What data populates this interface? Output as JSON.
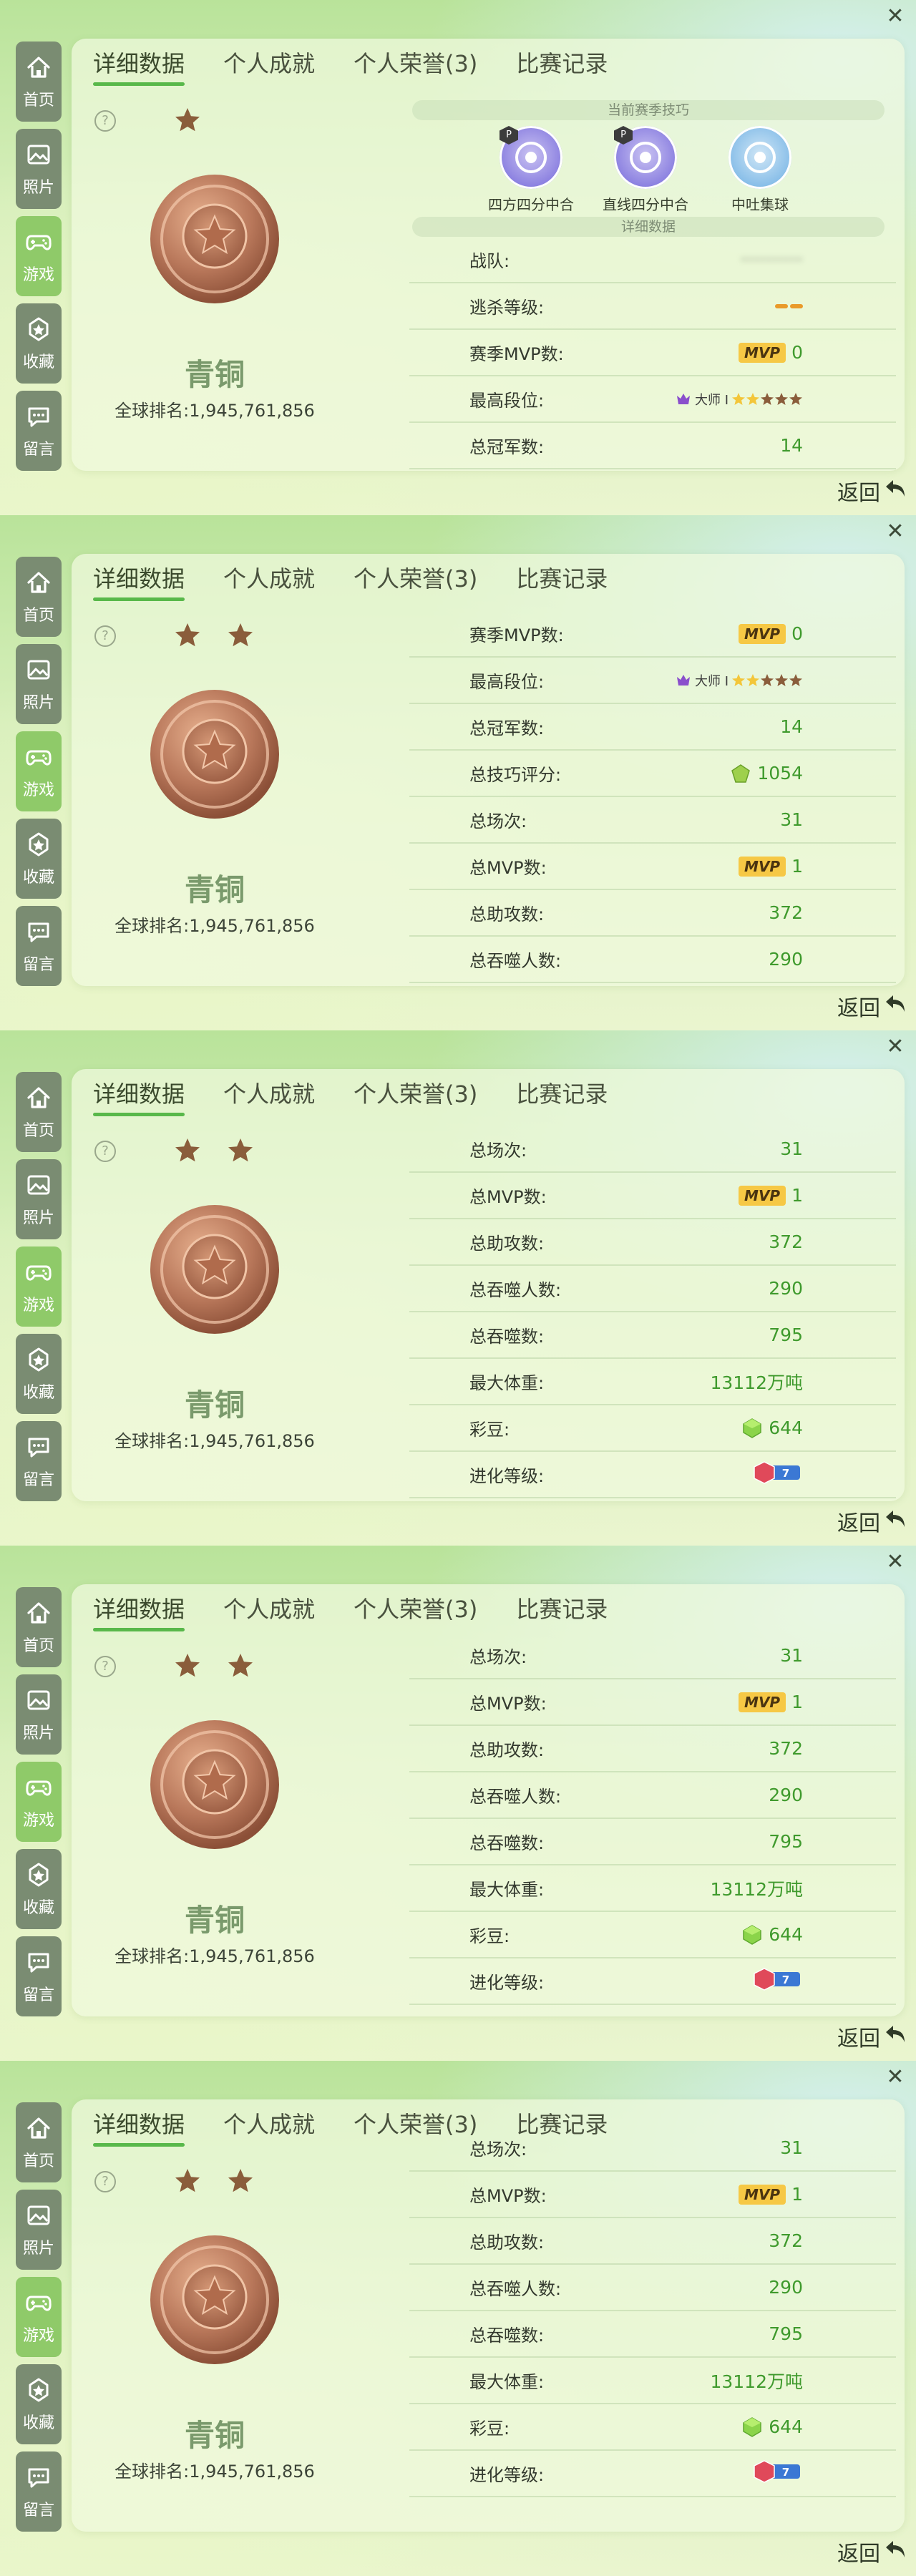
{
  "close_symbol": "✕",
  "sidebar": [
    {
      "label": "首页",
      "icon": "home-icon",
      "active": false
    },
    {
      "label": "照片",
      "icon": "photo-icon",
      "active": false
    },
    {
      "label": "游戏",
      "icon": "gamepad-icon",
      "active": true
    },
    {
      "label": "收藏",
      "icon": "star-badge-icon",
      "active": false
    },
    {
      "label": "留言",
      "icon": "message-icon",
      "active": false
    }
  ],
  "tabs": [
    "详细数据",
    "个人成就",
    "个人荣誉(3)",
    "比赛记录"
  ],
  "help_symbol": "?",
  "rank_name": "青铜",
  "global_rank": "全球排名:1,945,761,856",
  "back_label": "返回",
  "section_current_skills": "当前赛季技巧",
  "section_details": "详细数据",
  "skills": [
    {
      "name": "四方四分中合",
      "badge": "P",
      "colors": [
        "#c9c2f2",
        "#8a7fe0"
      ]
    },
    {
      "name": "直线四分中合",
      "badge": "P",
      "colors": [
        "#c9c2f2",
        "#8a7fe0"
      ]
    },
    {
      "name": "中吐集球",
      "badge": "",
      "colors": [
        "#cfe6f6",
        "#86bde8"
      ]
    }
  ],
  "mvp_badge": "MVP",
  "segment_text": "大师 I",
  "stats": {
    "team_label": "战队:",
    "team_value": "···········",
    "kill_level_label": "逃杀等级:",
    "season_mvp_label": "赛季MVP数:",
    "season_mvp": "0",
    "max_segment_label": "最高段位:",
    "total_champion_label": "总冠军数:",
    "total_champion": "14",
    "skill_score_label": "总技巧评分:",
    "skill_score": "1054",
    "total_games_label": "总场次:",
    "total_games": "31",
    "total_mvp_label": "总MVP数:",
    "total_mvp": "1",
    "total_assists_label": "总助攻数:",
    "total_assists": "372",
    "total_devour_people_label": "总吞噬人数:",
    "total_devour_people": "290",
    "total_devour_label": "总吞噬数:",
    "total_devour": "795",
    "max_weight_label": "最大体重:",
    "max_weight": "13112万吨",
    "beans_label": "彩豆:",
    "beans": "644",
    "evolution_label": "进化等级:",
    "evolution": "7"
  }
}
